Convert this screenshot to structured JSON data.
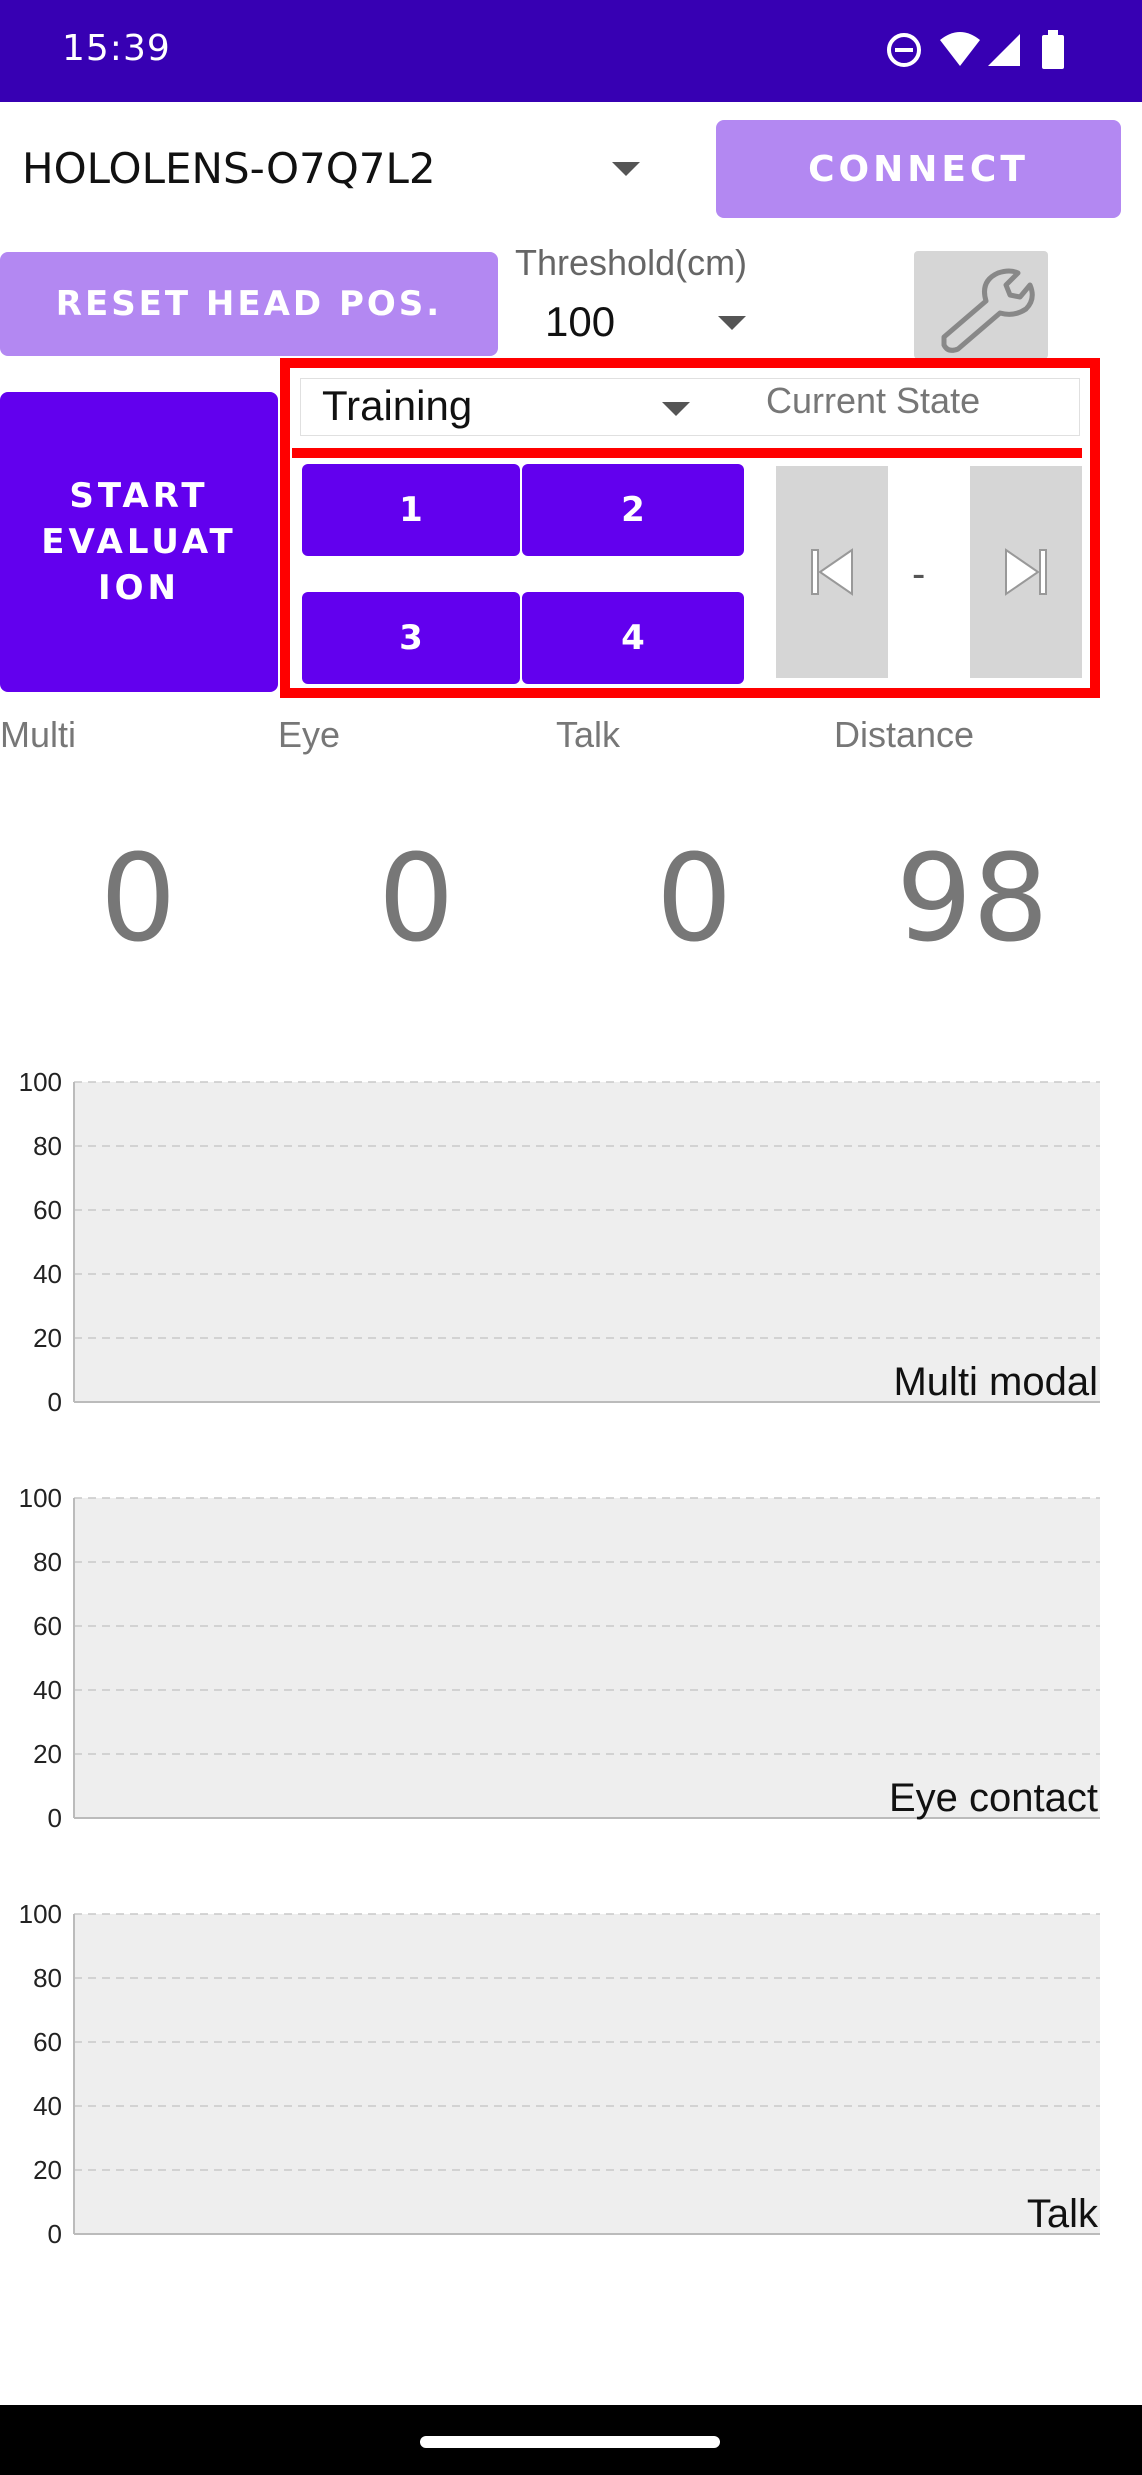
{
  "status_bar": {
    "time": "15:39",
    "icons": [
      "do-not-disturb-icon",
      "wifi-icon",
      "signal-icon",
      "battery-icon"
    ]
  },
  "device": {
    "name": "HOLOLENS-O7Q7L2",
    "connect_label": "CONNECT"
  },
  "controls": {
    "reset_label": "RESET HEAD POS.",
    "threshold_label": "Threshold(cm)",
    "threshold_value": "100",
    "settings_icon": "wrench-icon",
    "start_label": "START EVALUAT ION"
  },
  "session": {
    "mode": "Training",
    "current_state_label": "Current State",
    "buttons": [
      "1",
      "2",
      "3",
      "4"
    ],
    "state_value": "-",
    "prev_icon": "skip-previous-icon",
    "next_icon": "skip-next-icon"
  },
  "metrics": {
    "labels": [
      "Multi",
      "Eye",
      "Talk",
      "Distance"
    ],
    "values": [
      "0",
      "0",
      "0",
      "98"
    ]
  },
  "colors": {
    "primary": "#6200ee",
    "primary_light": "#b388f2",
    "status_bar": "#3700b3",
    "highlight": "#ff0000",
    "chart_bg": "#eeeeee"
  },
  "chart_data": [
    {
      "type": "line",
      "title": "Multi modal",
      "ylim": [
        0,
        100
      ],
      "yticks": [
        "0",
        "20",
        "40",
        "60",
        "80",
        "100"
      ],
      "series": [],
      "grid": true
    },
    {
      "type": "line",
      "title": "Eye contact",
      "ylim": [
        0,
        100
      ],
      "yticks": [
        "0",
        "20",
        "40",
        "60",
        "80",
        "100"
      ],
      "series": [],
      "grid": true
    },
    {
      "type": "line",
      "title": "Talk",
      "ylim": [
        0,
        100
      ],
      "yticks": [
        "0",
        "20",
        "40",
        "60",
        "80",
        "100"
      ],
      "series": [],
      "grid": true
    }
  ]
}
